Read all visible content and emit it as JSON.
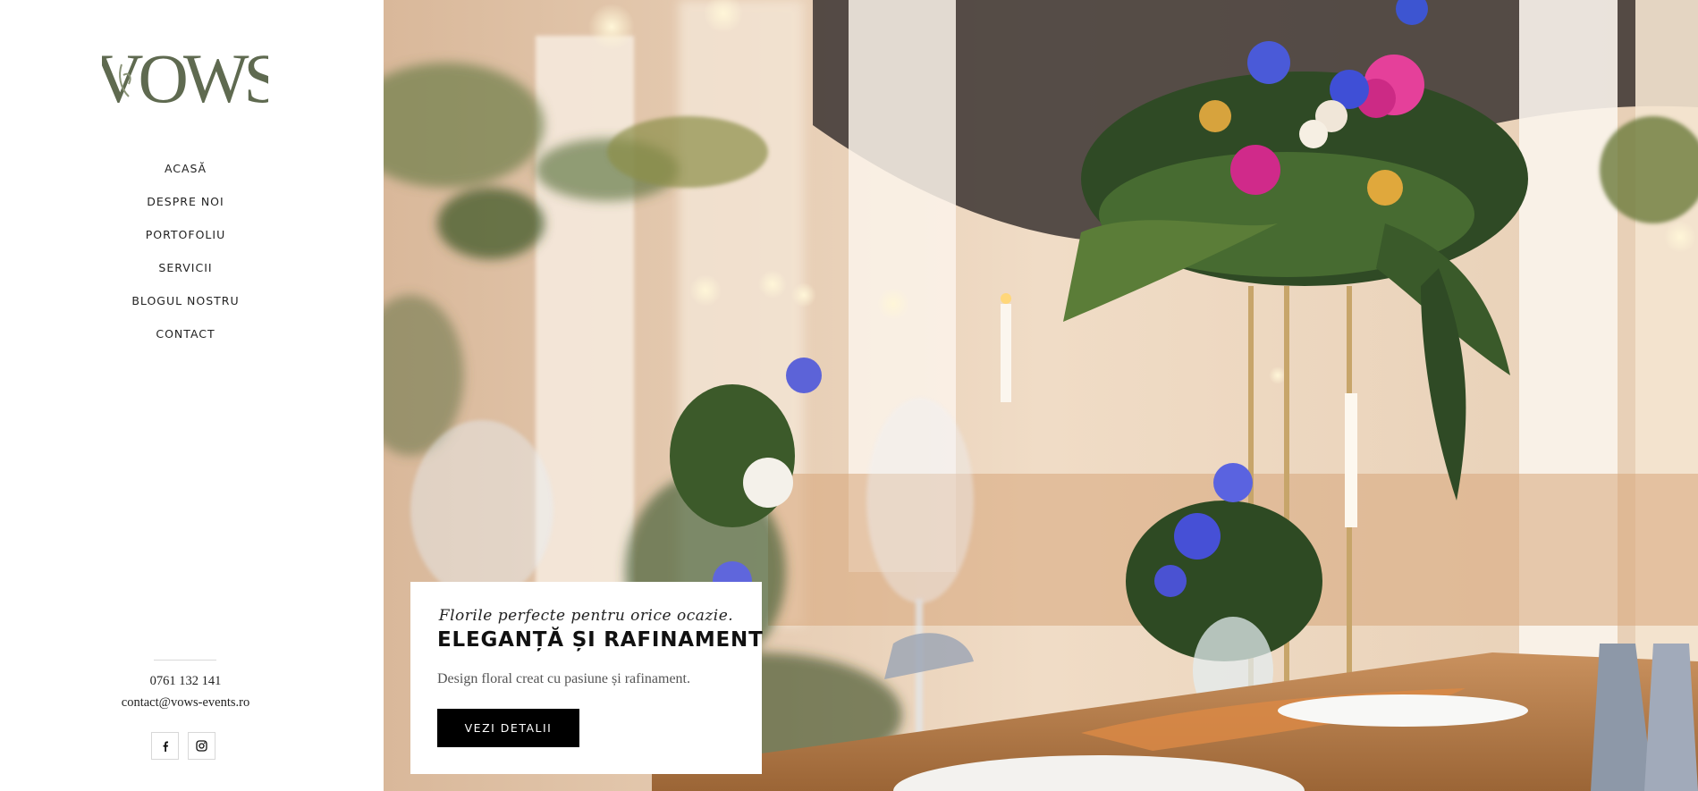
{
  "brand": {
    "logo_text": "VOWS",
    "logo_color": "#5f6a50"
  },
  "nav": {
    "items": [
      {
        "label": "ACASĂ"
      },
      {
        "label": "DESPRE NOI"
      },
      {
        "label": "PORTOFOLIU"
      },
      {
        "label": "SERVICII"
      },
      {
        "label": "BLOGUL NOSTRU"
      },
      {
        "label": "CONTACT"
      }
    ]
  },
  "contact": {
    "phone": "0761 132 141",
    "email": "contact@vows-events.ro"
  },
  "social": [
    {
      "icon": "facebook-icon"
    },
    {
      "icon": "instagram-icon"
    }
  ],
  "hero": {
    "image_subject": "wedding table decor with floral centerpiece",
    "tagline": "Florile perfecte pentru orice ocazie.",
    "headline": "ELEGANȚĂ ȘI RAFINAMENT",
    "description": "Design floral creat cu pasiune și rafinament.",
    "cta_label": "VEZI DETALII"
  },
  "colors": {
    "accent": "#000000",
    "sidebar_bg": "#ffffff",
    "text": "#222222"
  }
}
